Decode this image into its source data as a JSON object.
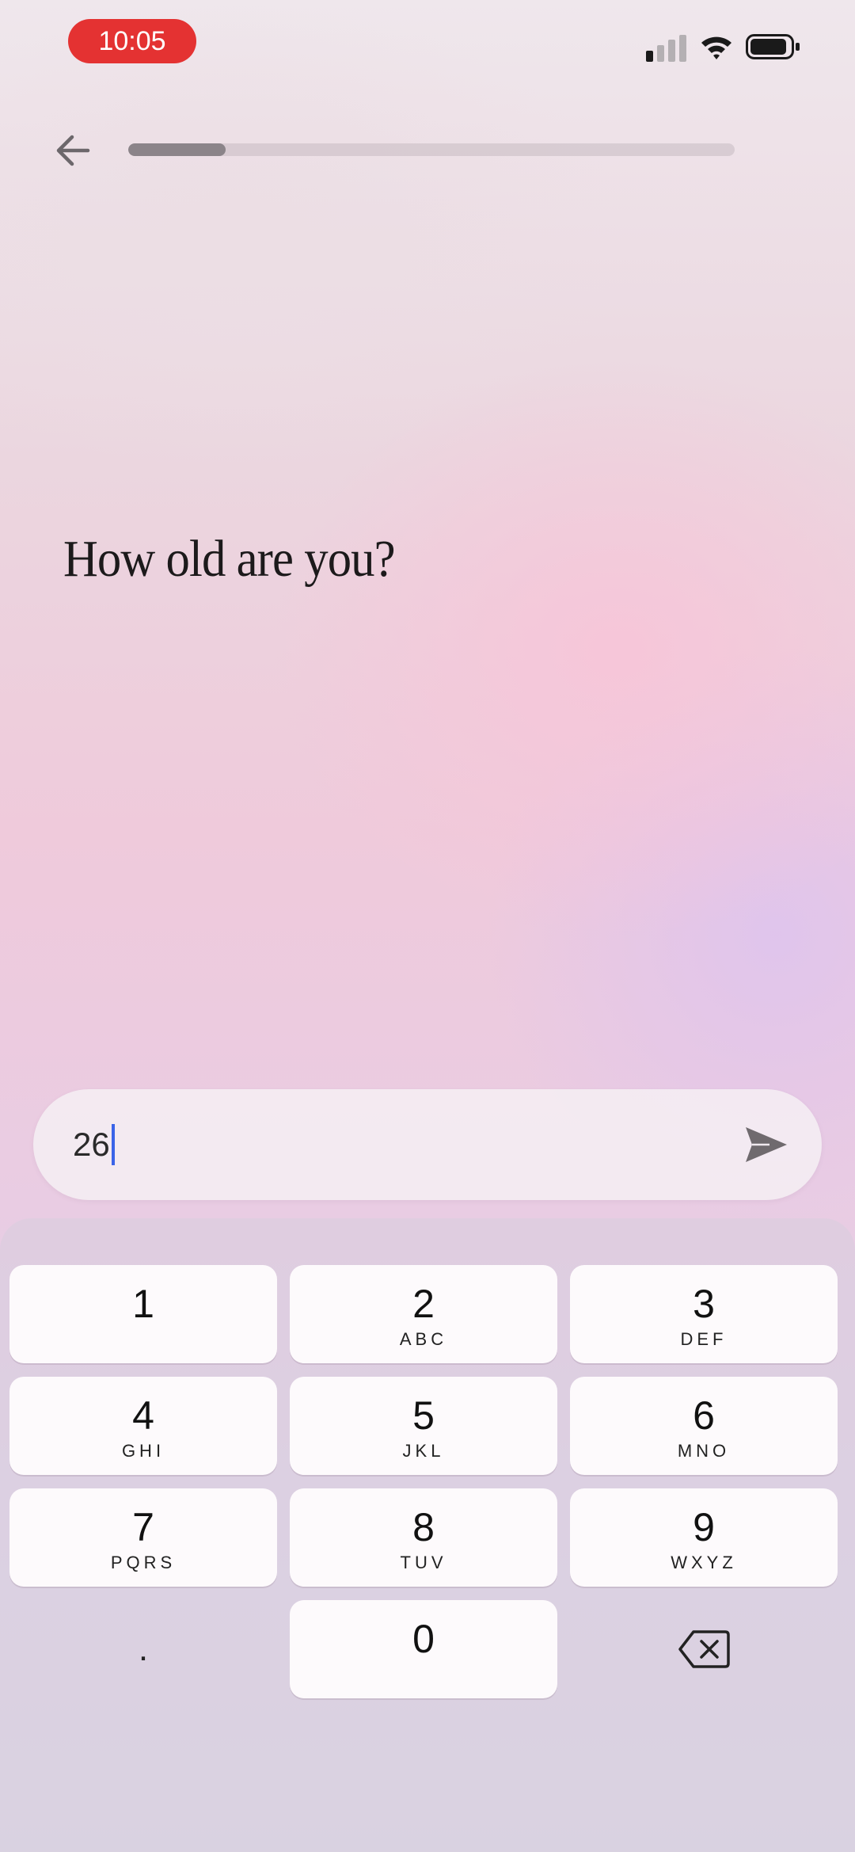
{
  "status_bar": {
    "time": "10:05",
    "signal_icon": "signal-icon",
    "wifi_icon": "wifi-icon",
    "battery_icon": "battery-icon"
  },
  "nav": {
    "back_icon": "arrow-left-icon",
    "progress_fraction": 0.16
  },
  "question": {
    "text": "How old are you?"
  },
  "answer": {
    "value": "26",
    "send_icon": "send-icon"
  },
  "keypad": {
    "keys": [
      {
        "digit": "1",
        "letters": ""
      },
      {
        "digit": "2",
        "letters": "ABC"
      },
      {
        "digit": "3",
        "letters": "DEF"
      },
      {
        "digit": "4",
        "letters": "GHI"
      },
      {
        "digit": "5",
        "letters": "JKL"
      },
      {
        "digit": "6",
        "letters": "MNO"
      },
      {
        "digit": "7",
        "letters": "PQRS"
      },
      {
        "digit": "8",
        "letters": "TUV"
      },
      {
        "digit": "9",
        "letters": "WXYZ"
      },
      {
        "digit": "0",
        "letters": ""
      }
    ],
    "dot_label": ".",
    "delete_icon": "backspace-icon"
  },
  "colors": {
    "status_pill": "#e43232",
    "caret": "#3a64e8",
    "progress_fill": "#8b8489",
    "send_icon": "#6f6a6e"
  }
}
